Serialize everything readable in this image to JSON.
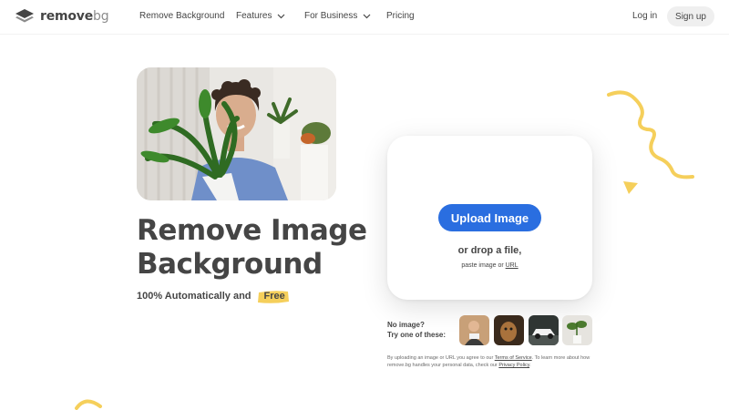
{
  "nav": {
    "logo_main": "remove",
    "logo_suffix": "bg",
    "links": [
      {
        "label": "Remove Background"
      },
      {
        "label": "Features"
      },
      {
        "label": "For Business"
      },
      {
        "label": "Pricing"
      }
    ],
    "login": "Log in",
    "signup": "Sign up"
  },
  "hero": {
    "title_line1": "Remove Image",
    "title_line2": "Background",
    "subtitle": "100% Automatically and",
    "free_badge": "Free"
  },
  "upload": {
    "button": "Upload Image",
    "drop_text": "or drop a file,",
    "paste_prefix": "paste image or",
    "paste_link": "URL"
  },
  "samples": {
    "line1": "No image?",
    "line2": "Try one of these:",
    "thumbs": [
      "person",
      "animal",
      "car",
      "plant"
    ]
  },
  "legal": {
    "text1": "By uploading an image or URL you agree to our",
    "tos": "Terms of Service",
    "text2": ". To learn more about how remove.bg handles your personal data, check our",
    "privacy": "Privacy Policy",
    "text3": "."
  },
  "colors": {
    "accent": "#2a6ee0",
    "highlight": "#f5cf5b",
    "text": "#454545"
  }
}
